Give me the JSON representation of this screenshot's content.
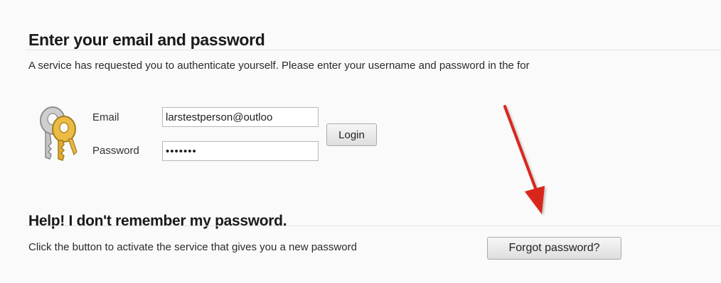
{
  "login_section": {
    "heading": "Enter your email and password",
    "intro": "A service has requested you to authenticate yourself. Please enter your username and password in the for",
    "email_label": "Email",
    "email_value": "larstestperson@outloo",
    "password_label": "Password",
    "password_value": "•••••••",
    "login_button": "Login"
  },
  "help_section": {
    "heading": "Help! I don't remember my password.",
    "text": "Click the button to activate the service that gives you a new password",
    "forgot_button": "Forgot password?"
  },
  "colors": {
    "arrow": "#d9261c",
    "key_gold": "#e5b53a",
    "key_silver": "#c9c9c9"
  },
  "icons": {
    "keys": "keys-icon",
    "arrow": "red-arrow-annotation"
  }
}
